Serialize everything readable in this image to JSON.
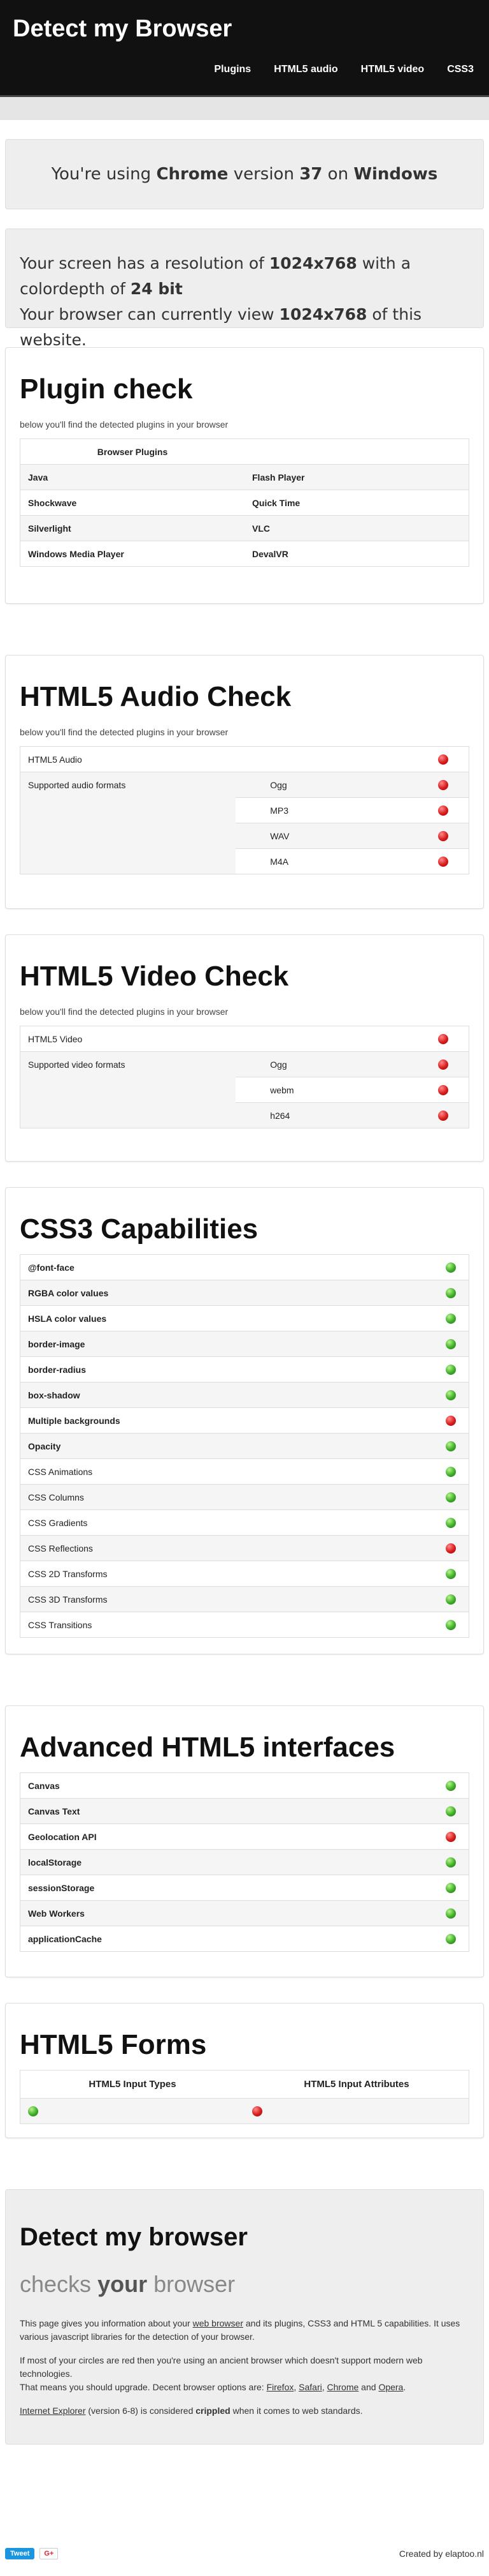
{
  "header": {
    "brand": "Detect my Browser",
    "nav": [
      "Plugins",
      "HTML5 audio",
      "HTML5 video",
      "CSS3"
    ]
  },
  "browser_info": {
    "prefix": "You're using",
    "browser": "Chrome",
    "version_label": "version",
    "version": "37",
    "on": "on",
    "os": "Windows"
  },
  "screen_info": {
    "line1_prefix": "Your screen has a resolution of",
    "resolution": "1024x768",
    "line1_suffix": "with a",
    "line2_prefix": "colordepth of",
    "depth": "24 bit",
    "line3_prefix": "Your browser can currently view",
    "view": "1024x768",
    "line3_suffix": "of this website."
  },
  "plugins": {
    "title": "Plugin check",
    "subtitle": "below you'll find the detected plugins in your browser",
    "header": "Browser Plugins",
    "rows": [
      [
        "Java",
        "Flash Player"
      ],
      [
        "Shockwave",
        "Quick Time"
      ],
      [
        "Silverlight",
        "VLC"
      ],
      [
        "Windows Media Player",
        "DevalVR"
      ]
    ]
  },
  "audio": {
    "title": "HTML5 Audio Check",
    "subtitle": "below you'll find the detected plugins in your browser",
    "main_label": "HTML5 Audio",
    "main_status": "red",
    "formats_label": "Supported audio formats",
    "formats": [
      {
        "name": "Ogg",
        "status": "red"
      },
      {
        "name": "MP3",
        "status": "red"
      },
      {
        "name": "WAV",
        "status": "red"
      },
      {
        "name": "M4A",
        "status": "red"
      }
    ]
  },
  "video": {
    "title": "HTML5 Video Check",
    "subtitle": "below you'll find the detected plugins in your browser",
    "main_label": "HTML5 Video",
    "main_status": "red",
    "formats_label": "Supported video formats",
    "formats": [
      {
        "name": "Ogg",
        "status": "red"
      },
      {
        "name": "webm",
        "status": "red"
      },
      {
        "name": "h264",
        "status": "red"
      }
    ]
  },
  "css3": {
    "title": "CSS3 Capabilities",
    "items": [
      {
        "name": "@font-face",
        "status": "green",
        "bold": true
      },
      {
        "name": "RGBA color values",
        "status": "green",
        "bold": true
      },
      {
        "name": "HSLA color values",
        "status": "green",
        "bold": true
      },
      {
        "name": "border-image",
        "status": "green",
        "bold": true
      },
      {
        "name": "border-radius",
        "status": "green",
        "bold": true
      },
      {
        "name": "box-shadow",
        "status": "green",
        "bold": true
      },
      {
        "name": "Multiple backgrounds",
        "status": "red",
        "bold": true
      },
      {
        "name": "Opacity",
        "status": "green",
        "bold": true
      },
      {
        "name": "CSS Animations",
        "status": "green",
        "bold": false
      },
      {
        "name": "CSS Columns",
        "status": "green",
        "bold": false
      },
      {
        "name": "CSS Gradients",
        "status": "green",
        "bold": false
      },
      {
        "name": "CSS Reflections",
        "status": "red",
        "bold": false
      },
      {
        "name": "CSS 2D Transforms",
        "status": "green",
        "bold": false
      },
      {
        "name": "CSS 3D Transforms",
        "status": "green",
        "bold": false
      },
      {
        "name": "CSS Transitions",
        "status": "green",
        "bold": false
      }
    ]
  },
  "html5": {
    "title": "Advanced HTML5 interfaces",
    "items": [
      {
        "name": "Canvas",
        "status": "green"
      },
      {
        "name": "Canvas Text",
        "status": "green"
      },
      {
        "name": "Geolocation API",
        "status": "red"
      },
      {
        "name": "localStorage",
        "status": "green"
      },
      {
        "name": "sessionStorage",
        "status": "green"
      },
      {
        "name": "Web Workers",
        "status": "green"
      },
      {
        "name": "applicationCache",
        "status": "green"
      }
    ]
  },
  "forms": {
    "title": "HTML5 Forms",
    "col1": "HTML5 Input Types",
    "col2": "HTML5 Input Attributes",
    "status1": "green",
    "status2": "red"
  },
  "about": {
    "title": "Detect my browser",
    "tagline_pre": "checks",
    "tagline_bold": "your",
    "tagline_post": "browser",
    "p1_pre": "This page gives you information about your",
    "p1_link": "web browser",
    "p1_post": "and its plugins, CSS3 and HTML 5 capabilities. It uses various javascript libraries for the detection of your browser.",
    "p2_line1": "If most of your circles are red then you're using an ancient browser which doesn't support modern web technologies.",
    "p2_line2_pre": "That means you should upgrade. Decent browser options are:",
    "browsers": [
      "Firefox",
      "Safari",
      "Chrome",
      "Opera"
    ],
    "p3_link": "Internet Explorer",
    "p3_mid": "(version 6-8) is considered",
    "p3_bold": "crippled",
    "p3_post": "when it comes to web standards."
  },
  "footer": {
    "tweet": "Tweet",
    "gplus": "G+",
    "credit": "Created by elaptoo.nl"
  },
  "colors": {
    "red": "#d81c1c",
    "green": "#3fae2a"
  }
}
